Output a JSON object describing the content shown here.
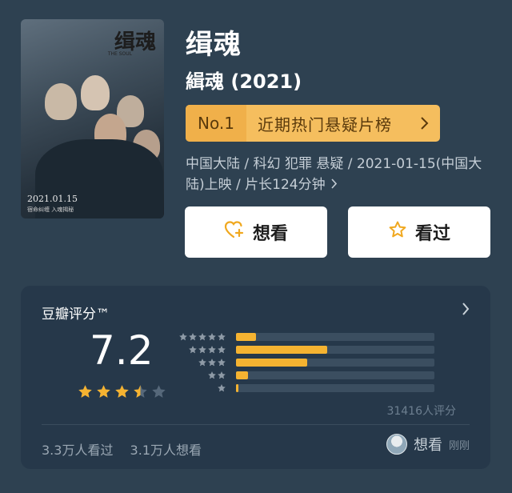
{
  "poster": {
    "title": "缉魂",
    "subtitle": "THE SOUL",
    "date": "2021.01.15",
    "tagline": "宿命纠缠 入魂揭秘"
  },
  "movie": {
    "title": "缉魂",
    "subtitle": "緝魂 (2021)"
  },
  "rank": {
    "number": "No.1",
    "label": "近期热门悬疑片榜"
  },
  "meta": {
    "text": "中国大陆 / 科幻 犯罪 悬疑 / 2021-01-15(中国大陆)上映 / 片长124分钟"
  },
  "actions": {
    "want_label": "想看",
    "seen_label": "看过"
  },
  "rating": {
    "title": "豆瓣评分™",
    "score": "7.2",
    "stars_filled": 3.5,
    "stars_total": 5,
    "distribution": [
      {
        "stars": 5,
        "fraction": 0.1
      },
      {
        "stars": 4,
        "fraction": 0.46
      },
      {
        "stars": 3,
        "fraction": 0.36
      },
      {
        "stars": 2,
        "fraction": 0.06
      },
      {
        "stars": 1,
        "fraction": 0.01
      }
    ],
    "count_text": "31416人评分",
    "seen_count": "3.3万人看过",
    "want_count": "3.1万人想看",
    "friend_action": "想看",
    "friend_time": "刚刚"
  },
  "colors": {
    "background": "#2e4151",
    "card": "#26384a",
    "accent": "#f5b331",
    "rank_bg": "#f5be5e"
  }
}
